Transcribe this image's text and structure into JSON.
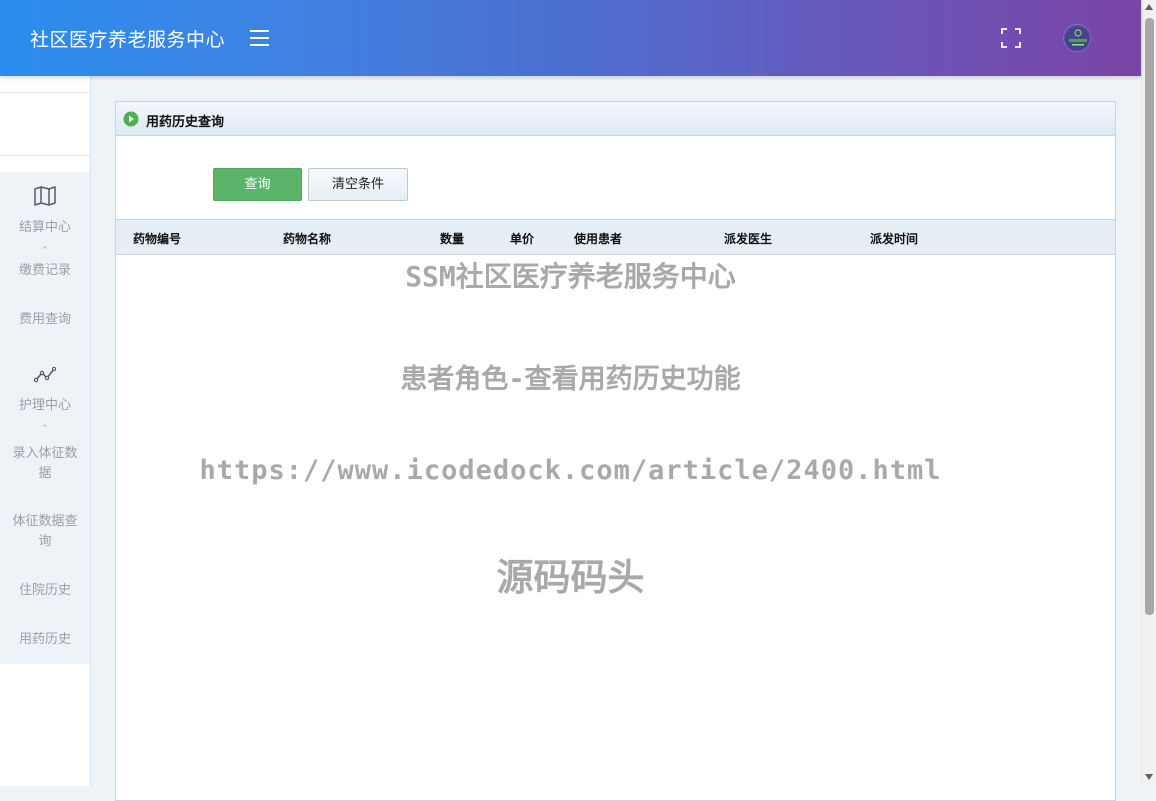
{
  "header": {
    "brand": "社区医疗养老服务中心",
    "menu_toggle_icon": "hamburger-icon",
    "fullscreen_icon": "fullscreen-icon",
    "avatar_icon": "user-avatar-icon"
  },
  "sidebar": {
    "groups": [
      {
        "label": "结算中心",
        "icon": "map-icon",
        "items": [
          "缴费记录",
          "费用查询"
        ]
      },
      {
        "label": "护理中心",
        "icon": "line-chart-icon",
        "items": [
          "录入体征数据",
          "体征数据查询",
          "住院历史",
          "用药历史"
        ]
      }
    ]
  },
  "panel": {
    "title": "用药历史查询",
    "title_icon": "play-circle-icon",
    "buttons": {
      "query": "查询",
      "clear": "清空条件"
    },
    "columns": [
      "药物编号",
      "药物名称",
      "数量",
      "单价",
      "使用患者",
      "派发医生",
      "派发时间"
    ]
  },
  "watermark": {
    "line1": "SSM社区医疗养老服务中心",
    "line2": "患者角色-查看用药历史功能",
    "line3": "https://www.icodedock.com/article/2400.html",
    "line4": "源码码头"
  },
  "colors": {
    "header_gradient_start": "#2a8ded",
    "header_gradient_end": "#7a45a6",
    "query_button": "#5cb46a",
    "sidebar_bg": "#eef3f7",
    "watermark": "#a9a9a9"
  }
}
